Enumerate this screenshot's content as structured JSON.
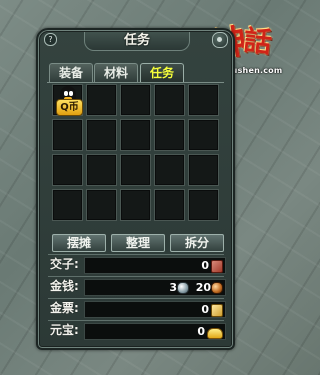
{
  "logo": {
    "text1": "神",
    "text2": "話",
    "url": "sh.wushen.com"
  },
  "window": {
    "title": "任务",
    "help_label": "?",
    "tabs": [
      {
        "label": "装备",
        "active": false
      },
      {
        "label": "材料",
        "active": false
      },
      {
        "label": "任务",
        "active": true
      }
    ],
    "grid": {
      "rows": 4,
      "cols": 5
    },
    "items": [
      {
        "slot": 0,
        "icon": "qq-penguin-icon",
        "label": "Q币"
      }
    ],
    "actions": [
      {
        "label": "摆摊"
      },
      {
        "label": "整理"
      },
      {
        "label": "拆分"
      }
    ],
    "currency": {
      "jiaozi": {
        "label": "交子:",
        "value": "0"
      },
      "money": {
        "label": "金钱:",
        "silver": "3",
        "copper": "20"
      },
      "jinpiao": {
        "label": "金票:",
        "value": "0"
      },
      "yuanbao": {
        "label": "元宝:",
        "value": "0"
      }
    }
  },
  "colors": {
    "active_tab_text": "#f6ff3a",
    "panel_bg": "#34433f",
    "slot_bg": "#141817"
  }
}
